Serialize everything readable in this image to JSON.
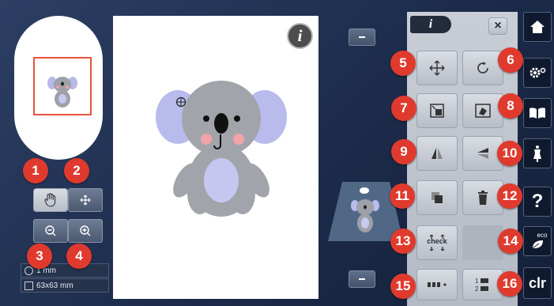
{
  "left_panel": {
    "status_stitch_count": "1 mm",
    "status_size": "63x63 mm"
  },
  "canvas": {
    "info_label": "i"
  },
  "right_panel": {
    "header_info_label": "i",
    "close_label": "×",
    "check_label": "check"
  },
  "side_menu": {
    "help_label": "?",
    "eco_label": "eco",
    "clr_label": "clr"
  },
  "badges": [
    "1",
    "2",
    "3",
    "4",
    "5",
    "6",
    "7",
    "8",
    "9",
    "10",
    "11",
    "12",
    "13",
    "14",
    "15",
    "16"
  ],
  "colors": {
    "badge": "#e03a2e",
    "background": "#1b2a48",
    "frame": "#e8543b"
  }
}
